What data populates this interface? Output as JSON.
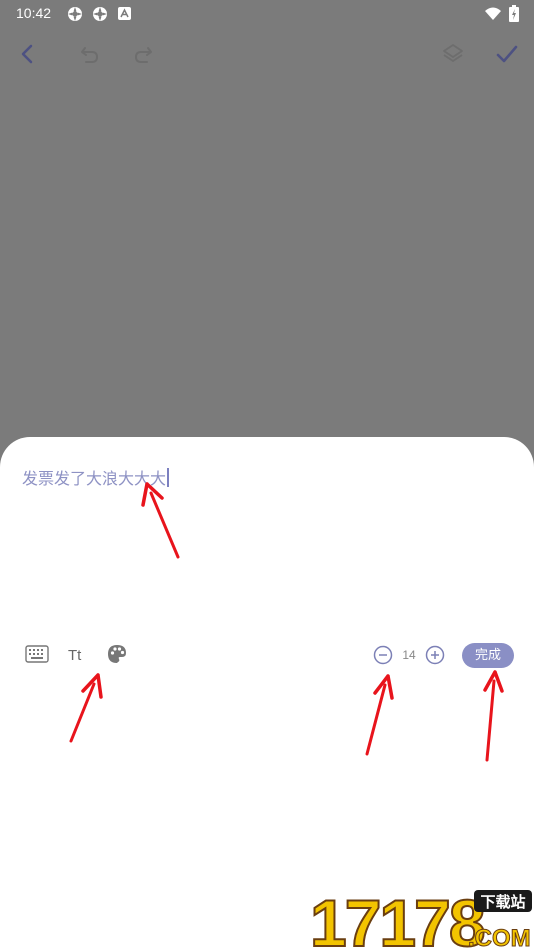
{
  "status_bar": {
    "time": "10:42"
  },
  "toolbar": {
    "back_icon": "back-icon",
    "undo_icon": "undo-icon",
    "redo_icon": "redo-icon",
    "layers_icon": "layers-icon",
    "confirm_icon": "check-icon"
  },
  "editor": {
    "text": "发票发了大浪大大大",
    "font_size": "14",
    "done_label": "完成",
    "text_style_label": "Tt"
  },
  "watermark": {
    "number": "17178",
    "badge": "下载站",
    "domain": ".COM"
  },
  "colors": {
    "accent": "#8a8fc5",
    "overlay": "#7b7b7b",
    "arrow": "#e8141c"
  }
}
